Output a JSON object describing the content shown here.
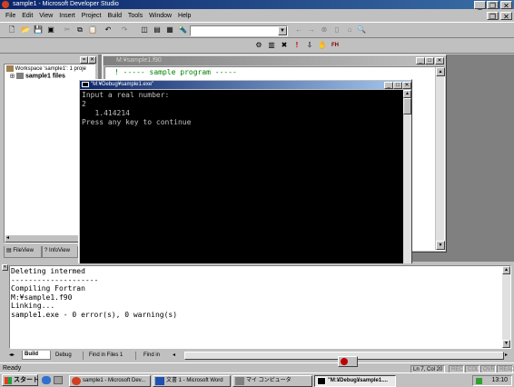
{
  "app": {
    "title": "sample1 - Microsoft Developer Studio"
  },
  "menu": [
    "File",
    "Edit",
    "View",
    "Insert",
    "Project",
    "Build",
    "Tools",
    "Window",
    "Help"
  ],
  "workspace": {
    "root": "Workspace 'sample1': 1 proje",
    "project": "sample1 files",
    "tabs": [
      "FileView",
      "InfoView"
    ]
  },
  "editor": {
    "title": "M:¥sample1.f90",
    "lines": [
      "! ----- sample program -----"
    ]
  },
  "console": {
    "title": "\"M:¥Debug¥sample1.exe\"",
    "lines": [
      "Input a real number:",
      "2",
      "   1.414214",
      "Press any key to continue"
    ]
  },
  "output": {
    "lines": [
      "Deleting intermed",
      "--------------------",
      "Compiling Fortran",
      "M:¥sample1.f90",
      "Linking...",
      "",
      "sample1.exe - 0 error(s), 0 warning(s)"
    ],
    "tabs": [
      "Build",
      "Debug",
      "Find in Files 1",
      "Find in"
    ]
  },
  "status": {
    "text": "Ready",
    "position": "Ln 7, Col 20",
    "indicators": [
      "REC",
      "COL",
      "OVR",
      "READ"
    ]
  },
  "taskbar": {
    "start": "スタート",
    "tasks": [
      "sample1 - Microsoft Dev...",
      "文書 1 - Microsoft Word",
      "マイ コンピュータ",
      "\"M:¥Debug¥sample1...."
    ],
    "clock": "13:10"
  }
}
